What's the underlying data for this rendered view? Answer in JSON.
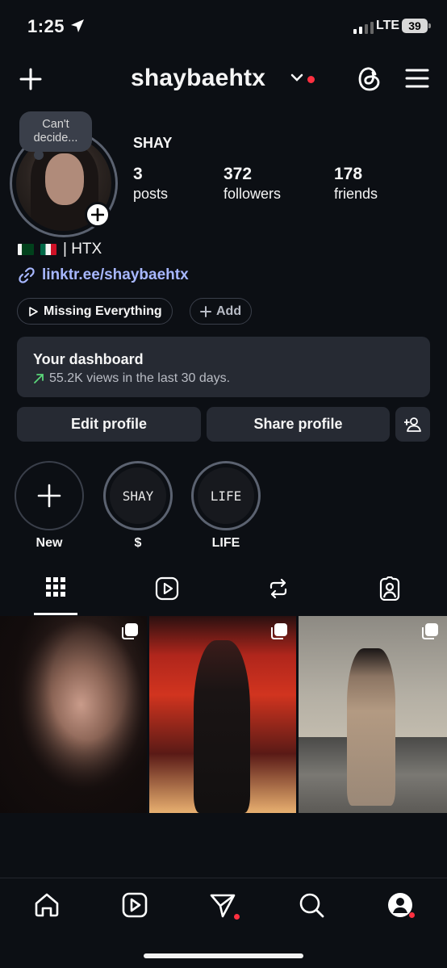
{
  "status_bar": {
    "time": "1:25",
    "network": "LTE",
    "battery": "39"
  },
  "header": {
    "username": "shaybaehtx"
  },
  "profile": {
    "note": "Can't decide...",
    "display_name": "SHAY",
    "stats": [
      {
        "value": "3",
        "label": "posts"
      },
      {
        "value": "372",
        "label": "followers"
      },
      {
        "value": "178",
        "label": "friends"
      }
    ],
    "bio": "| HTX",
    "link": "linktr.ee/shaybaehtx",
    "music_chip": "Missing Everything",
    "add_chip": "Add"
  },
  "dashboard": {
    "title": "Your dashboard",
    "subtitle": "55.2K views in the last 30 days."
  },
  "buttons": {
    "edit": "Edit profile",
    "share": "Share profile"
  },
  "highlights": [
    {
      "cover": "",
      "label": "New"
    },
    {
      "cover": "SHAY",
      "label": "$"
    },
    {
      "cover": "LIFE",
      "label": "LIFE"
    }
  ],
  "tabs": [
    "grid-icon",
    "reels-icon",
    "reposts-icon",
    "tagged-icon"
  ],
  "bottom_nav": [
    "home-icon",
    "reels-icon",
    "direct-icon",
    "search-icon",
    "profile-icon"
  ],
  "colors": {
    "background": "#0c0f14",
    "card": "#262a33",
    "link": "#a7b7ff",
    "notification": "#ff3040"
  }
}
